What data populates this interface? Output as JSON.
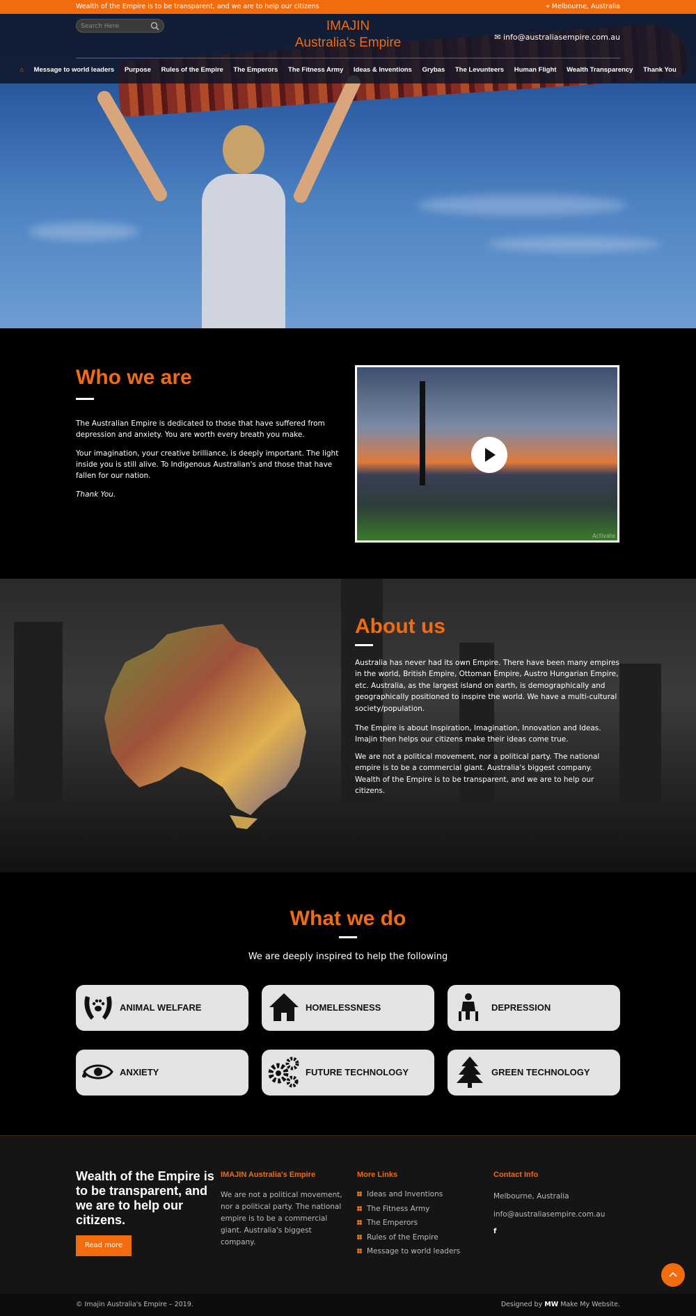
{
  "topbar": {
    "tagline": "Wealth of the Empire is to be transparent, and we are to help our citizens",
    "location": "Melbourne, Australia"
  },
  "header": {
    "search_placeholder": "Search Here",
    "logo_line1": "IMAJIN",
    "logo_line2": "Australia's Empire",
    "email": "info@australiasempire.com.au"
  },
  "nav": {
    "items": [
      "Message to world leaders",
      "Purpose",
      "Rules of the Empire",
      "The Emperors",
      "The Fitness Army",
      "Ideas & Inventions",
      "Grybas",
      "The Levunteers",
      "Human Flight",
      "Wealth Transparency",
      "Thank You"
    ]
  },
  "who": {
    "title": "Who we are",
    "p1": "The Australian Empire is dedicated to those that have suffered from depression and anxiety. You are worth every breath you make.",
    "p2": "Your imagination, your creative brilliance, is deeply important. The light inside you is still alive. To Indigenous Australian's and those that have fallen for our nation.",
    "p3": "Thank You.",
    "video_watermark": "Activate"
  },
  "about": {
    "title": "About us",
    "p1": "Australia has never had its own Empire. There have been many empires in the world, British Empire, Ottoman Empire, Austro Hungarian Empire, etc. Australia, as the largest island on earth, is demographically and geographically positioned to inspire the world. We have a multi-cultural society/population.",
    "p2": "The Empire is about Inspiration, Imagination, Innovation and Ideas. Imajin then helps our citizens make their ideas come true.",
    "p3": "We are not a political movement, nor a political party. The national empire is to be a commercial giant. Australia's biggest company. Wealth of the Empire is to be transparent, and we are to help our citizens."
  },
  "what": {
    "title": "What we do",
    "subtitle": "We are deeply inspired to help the following",
    "cards": [
      {
        "label": "ANIMAL WELFARE",
        "icon": "animal-welfare-icon"
      },
      {
        "label": "HOMELESSNESS",
        "icon": "house-icon"
      },
      {
        "label": "DEPRESSION",
        "icon": "depression-icon"
      },
      {
        "label": "ANXIETY",
        "icon": "eye-icon"
      },
      {
        "label": "FUTURE TECHNOLOGY",
        "icon": "gears-icon"
      },
      {
        "label": "GREEN TECHNOLOGY",
        "icon": "tree-icon"
      }
    ]
  },
  "footer": {
    "tagline": "Wealth of the Empire is to be transparent, and we are to help our citizens.",
    "read_more": "Read more",
    "col2_title": "IMAJIN Australia's Empire",
    "col2_text": "We are not a political movement, nor a political party. The national empire is to be a commercial giant. Australia's biggest company.",
    "col3_title": "More Links",
    "links": [
      "Ideas and Inventions",
      "The Fitness Army",
      "The Emperors",
      "Rules of the Empire",
      "Message to world leaders"
    ],
    "col4_title": "Contact Info",
    "contact_location": "Melbourne, Australia",
    "contact_email": "info@australiasempire.com.au",
    "facebook": "f"
  },
  "copyright": {
    "left": "© Imajin Australia's Empire – 2019.",
    "designed_by": "Designed by",
    "brand": "Make My Website."
  },
  "colors": {
    "accent": "#f26c0d",
    "card_bg": "#e3e3e3"
  }
}
